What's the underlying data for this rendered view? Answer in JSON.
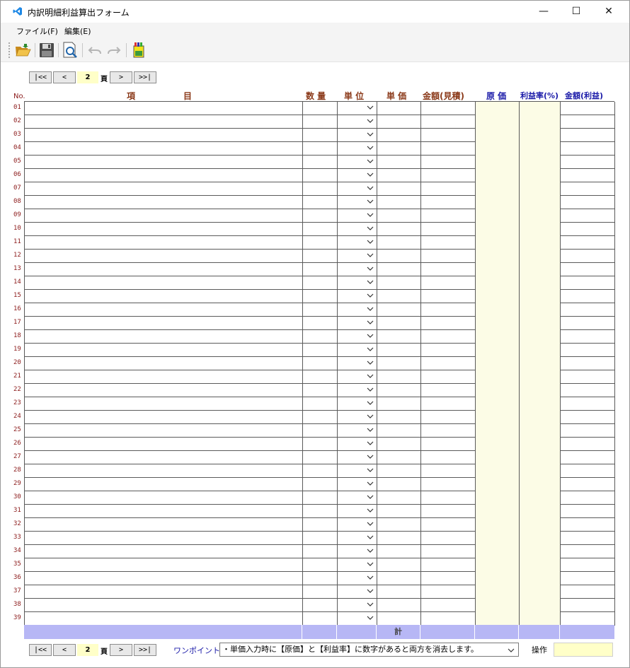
{
  "window": {
    "title": "内訳明細利益算出フォーム",
    "minimize": "—",
    "maximize": "☐",
    "close": "✕"
  },
  "menu": [
    "ファイル(F)",
    "編集(E)"
  ],
  "toolbar": [
    "open-folder-icon",
    "save-icon",
    "print-preview-icon",
    "undo-icon",
    "redo-icon",
    "calculator-icon"
  ],
  "pager": {
    "first": "|<<",
    "prev": "<",
    "page": "2",
    "unit": "頁",
    "next": ">",
    "last": ">>|"
  },
  "headers": {
    "no": "No.",
    "item1": "項",
    "item2": "目",
    "qty": "数 量",
    "unit": "単 位",
    "unit_price": "単 価",
    "amount_est": "金額(見積)",
    "cost": "原 価",
    "profit_rate": "利益率(%)",
    "amount_profit": "金額(利益)"
  },
  "rows": [
    "01",
    "02",
    "03",
    "04",
    "05",
    "06",
    "07",
    "08",
    "09",
    "10",
    "11",
    "12",
    "13",
    "14",
    "15",
    "16",
    "17",
    "18",
    "19",
    "20",
    "21",
    "22",
    "23",
    "24",
    "25",
    "26",
    "27",
    "28",
    "29",
    "30",
    "31",
    "32",
    "33",
    "34",
    "35",
    "36",
    "37",
    "38",
    "39"
  ],
  "total_label": "計",
  "footer": {
    "hint_label": "ワンポイント:",
    "hint_text": "・単価入力時に【原価】と【利益率】に数字があると両方を消去します。",
    "op_label": "操作",
    "op_value": ""
  },
  "colors": {
    "brown_header": "#8b3a1a",
    "blue_header": "#1a1aa8",
    "cost_fill": "#fcfce6",
    "total_fill": "#b7b7f5",
    "input_yellow": "#ffffc8"
  }
}
